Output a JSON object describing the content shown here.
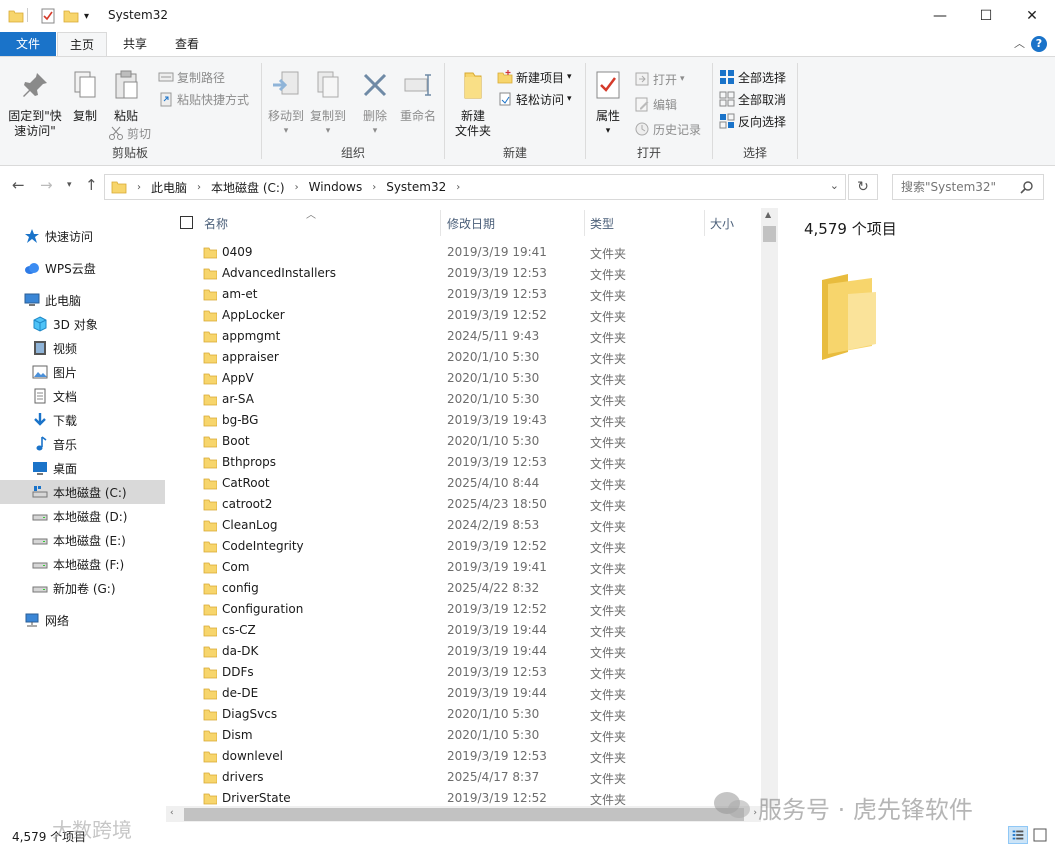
{
  "window": {
    "title": "System32",
    "minimize_glyph": "—",
    "maximize_glyph": "☐",
    "close_glyph": "✕"
  },
  "tabs": {
    "file": "文件",
    "home": "主页",
    "share": "共享",
    "view": "查看",
    "help": "?"
  },
  "ribbon": {
    "clipboard": {
      "label": "剪贴板",
      "pin": "固定到\"快速访问\"",
      "copy": "复制",
      "paste": "粘贴",
      "copy_path": "复制路径",
      "paste_shortcut": "粘贴快捷方式",
      "cut": "剪切"
    },
    "organize": {
      "label": "组织",
      "move_to": "移动到",
      "copy_to": "复制到",
      "delete": "删除",
      "rename": "重命名"
    },
    "new": {
      "label": "新建",
      "new_folder": "新建\n文件夹",
      "new_item": "新建项目",
      "easy_access": "轻松访问"
    },
    "open": {
      "label": "打开",
      "properties": "属性",
      "open": "打开",
      "edit": "编辑",
      "history": "历史记录"
    },
    "select": {
      "label": "选择",
      "select_all": "全部选择",
      "select_none": "全部取消",
      "invert": "反向选择"
    }
  },
  "address": {
    "crumbs": [
      "此电脑",
      "本地磁盘 (C:)",
      "Windows",
      "System32"
    ],
    "search_placeholder": "搜索\"System32\""
  },
  "nav": [
    {
      "label": "快速访问",
      "icon": "star-icon",
      "indent": 1
    },
    {
      "label": "WPS云盘",
      "icon": "cloud-icon",
      "indent": 1
    },
    {
      "label": "此电脑",
      "icon": "computer-icon",
      "indent": 1
    },
    {
      "label": "3D 对象",
      "icon": "cube-icon",
      "indent": 2
    },
    {
      "label": "视频",
      "icon": "video-icon",
      "indent": 2
    },
    {
      "label": "图片",
      "icon": "picture-icon",
      "indent": 2
    },
    {
      "label": "文档",
      "icon": "document-icon",
      "indent": 2
    },
    {
      "label": "下载",
      "icon": "download-icon",
      "indent": 2
    },
    {
      "label": "音乐",
      "icon": "music-icon",
      "indent": 2
    },
    {
      "label": "桌面",
      "icon": "desktop-icon",
      "indent": 2
    },
    {
      "label": "本地磁盘 (C:)",
      "icon": "drive-c-icon",
      "indent": 2,
      "selected": true
    },
    {
      "label": "本地磁盘 (D:)",
      "icon": "drive-icon",
      "indent": 2
    },
    {
      "label": "本地磁盘 (E:)",
      "icon": "drive-icon",
      "indent": 2
    },
    {
      "label": "本地磁盘 (F:)",
      "icon": "drive-icon",
      "indent": 2
    },
    {
      "label": "新加卷 (G:)",
      "icon": "drive-icon",
      "indent": 2
    },
    {
      "label": "网络",
      "icon": "network-icon",
      "indent": 1
    }
  ],
  "list": {
    "columns": [
      "名称",
      "修改日期",
      "类型",
      "大小"
    ],
    "rows": [
      {
        "name": "0409",
        "date": "2019/3/19 19:41",
        "type": "文件夹"
      },
      {
        "name": "AdvancedInstallers",
        "date": "2019/3/19 12:53",
        "type": "文件夹"
      },
      {
        "name": "am-et",
        "date": "2019/3/19 12:53",
        "type": "文件夹"
      },
      {
        "name": "AppLocker",
        "date": "2019/3/19 12:52",
        "type": "文件夹"
      },
      {
        "name": "appmgmt",
        "date": "2024/5/11 9:43",
        "type": "文件夹"
      },
      {
        "name": "appraiser",
        "date": "2020/1/10 5:30",
        "type": "文件夹"
      },
      {
        "name": "AppV",
        "date": "2020/1/10 5:30",
        "type": "文件夹"
      },
      {
        "name": "ar-SA",
        "date": "2020/1/10 5:30",
        "type": "文件夹"
      },
      {
        "name": "bg-BG",
        "date": "2019/3/19 19:43",
        "type": "文件夹"
      },
      {
        "name": "Boot",
        "date": "2020/1/10 5:30",
        "type": "文件夹"
      },
      {
        "name": "Bthprops",
        "date": "2019/3/19 12:53",
        "type": "文件夹"
      },
      {
        "name": "CatRoot",
        "date": "2025/4/10 8:44",
        "type": "文件夹"
      },
      {
        "name": "catroot2",
        "date": "2025/4/23 18:50",
        "type": "文件夹"
      },
      {
        "name": "CleanLog",
        "date": "2024/2/19 8:53",
        "type": "文件夹"
      },
      {
        "name": "CodeIntegrity",
        "date": "2019/3/19 12:52",
        "type": "文件夹"
      },
      {
        "name": "Com",
        "date": "2019/3/19 19:41",
        "type": "文件夹"
      },
      {
        "name": "config",
        "date": "2025/4/22 8:32",
        "type": "文件夹"
      },
      {
        "name": "Configuration",
        "date": "2019/3/19 12:52",
        "type": "文件夹"
      },
      {
        "name": "cs-CZ",
        "date": "2019/3/19 19:44",
        "type": "文件夹"
      },
      {
        "name": "da-DK",
        "date": "2019/3/19 19:44",
        "type": "文件夹"
      },
      {
        "name": "DDFs",
        "date": "2019/3/19 12:53",
        "type": "文件夹"
      },
      {
        "name": "de-DE",
        "date": "2019/3/19 19:44",
        "type": "文件夹"
      },
      {
        "name": "DiagSvcs",
        "date": "2020/1/10 5:30",
        "type": "文件夹"
      },
      {
        "name": "Dism",
        "date": "2020/1/10 5:30",
        "type": "文件夹"
      },
      {
        "name": "downlevel",
        "date": "2019/3/19 12:53",
        "type": "文件夹"
      },
      {
        "name": "drivers",
        "date": "2025/4/17 8:37",
        "type": "文件夹"
      },
      {
        "name": "DriverState",
        "date": "2019/3/19 12:52",
        "type": "文件夹"
      }
    ]
  },
  "preview": {
    "count": "4,579 个项目"
  },
  "status": {
    "count": "4,579 个项目"
  },
  "watermarks": {
    "right": "服务号 · 虎先锋软件",
    "left": "大数跨境"
  },
  "colors": {
    "accent": "#1a73c9",
    "folder": "#f7d56c",
    "folder_dark": "#e8bc3e",
    "selection": "#d9d9d9"
  }
}
